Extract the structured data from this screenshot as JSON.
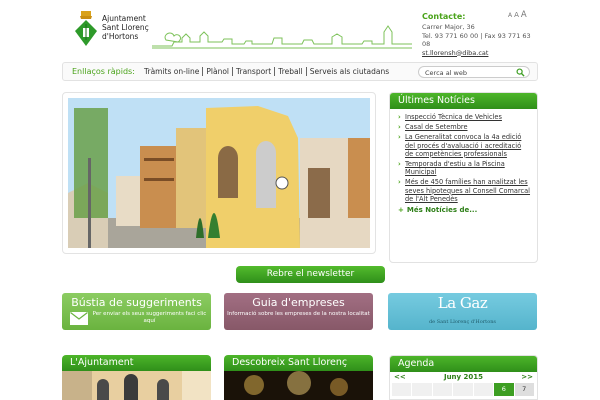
{
  "font_sizer": [
    "A",
    "A",
    "A"
  ],
  "header": {
    "org_name_lines": [
      "Ajuntament",
      "Sant Llorenç",
      "d'Hortons"
    ],
    "contact_title": "Contacte:",
    "contact_address": "Carrer Major, 36",
    "contact_phone": "Tel. 93 771 60 00 | Fax 93 771 63 08",
    "contact_email": "st.llorensh@diba.cat"
  },
  "quicklinks": {
    "title": "Enllaços ràpids:",
    "items": [
      "Tràmits on-line",
      "Plànol",
      "Transport",
      "Treball",
      "Serveis als ciutadans"
    ],
    "search_value": "Cerca al web"
  },
  "news": {
    "title": "Últimes Notícies",
    "items": [
      "Inspecció Tècnica de Vehicles",
      "Casal de Setembre",
      "La Generalitat convoca la 4a edició del procés d'avaluació i acreditació de competències professionals",
      "Temporada d'estiu a la Piscina Municipal",
      "Més de 450 famílies han analitzat les seves hipoteques al Consell Comarcal de l'Alt Penedès"
    ],
    "more_label": "Més Notícies de..."
  },
  "newsletter_label": "Rebre el newsletter",
  "banners": {
    "suggest_title": "Bústia de suggeriments",
    "suggest_sub": "Per enviar els seus suggeriments faci clic aquí",
    "guide_title": "Guia d'empreses",
    "guide_sub": "Informació sobre les empreses de la nostra localitat",
    "lagaz_title": "La Gaz",
    "lagaz_sub": "de Sant Llorenç d'Hortons"
  },
  "sections": {
    "ajuntament": "L'Ajuntament",
    "descobreix": "Descobreix Sant Llorenç",
    "agenda": "Agenda"
  },
  "agenda": {
    "prev": "<<",
    "month": "Juny 2015",
    "next": ">>",
    "visible_days": [
      "",
      "",
      "",
      "",
      "",
      "6",
      "7"
    ]
  },
  "colors": {
    "brand_green": "#4aa31a",
    "header_green": "#3d9e22",
    "suggest_green": "#7bbf50",
    "guide_mauve": "#94637a",
    "lagaz_blue": "#66c1d7"
  }
}
